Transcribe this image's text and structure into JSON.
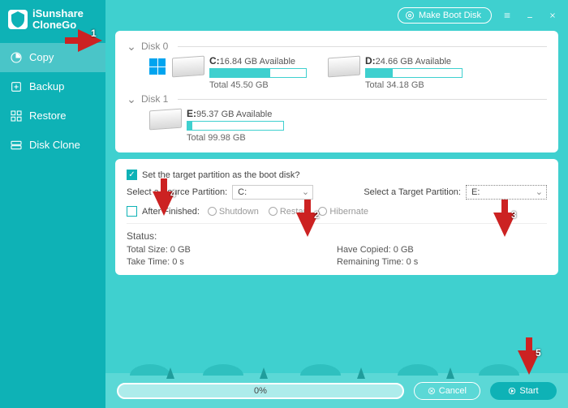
{
  "app": {
    "name": "iSunshare\nCloneGo"
  },
  "titlebar": {
    "make_boot": "Make Boot Disk"
  },
  "nav": {
    "items": [
      {
        "id": "copy",
        "label": "Copy",
        "active": true
      },
      {
        "id": "backup",
        "label": "Backup",
        "active": false
      },
      {
        "id": "restore",
        "label": "Restore",
        "active": false
      },
      {
        "id": "diskclone",
        "label": "Disk Clone",
        "active": false
      }
    ]
  },
  "disks": [
    {
      "name": "Disk 0",
      "partitions": [
        {
          "letter": "C:",
          "available": "16.84 GB Available",
          "total": "Total 45.50 GB",
          "fill_pct": 63,
          "is_os": true
        },
        {
          "letter": "D:",
          "available": "24.66 GB Available",
          "total": "Total 34.18 GB",
          "fill_pct": 28,
          "is_os": false
        }
      ]
    },
    {
      "name": "Disk 1",
      "partitions": [
        {
          "letter": "E:",
          "available": "95.37 GB Available",
          "total": "Total 99.98 GB",
          "fill_pct": 5,
          "is_os": false
        }
      ]
    }
  ],
  "options": {
    "boot_checkbox_label": "Set the target partition as the boot disk?",
    "boot_checked": true,
    "source_label": "Select a Source Partition:",
    "source_value": "C:",
    "target_label": "Select a Target Partition:",
    "target_value": "E:",
    "after_label": "After Finished:",
    "after_checked": false,
    "radios": [
      "Shutdown",
      "Restart",
      "Hibernate"
    ]
  },
  "status": {
    "title": "Status:",
    "total_size": "Total Size: 0 GB",
    "have_copied": "Have Copied: 0 GB",
    "take_time": "Take Time: 0 s",
    "remaining_time": "Remaining Time: 0 s"
  },
  "footer": {
    "progress_text": "0%",
    "cancel": "Cancel",
    "start": "Start"
  },
  "annotations": [
    "1",
    "2",
    "3",
    "4",
    "5"
  ]
}
